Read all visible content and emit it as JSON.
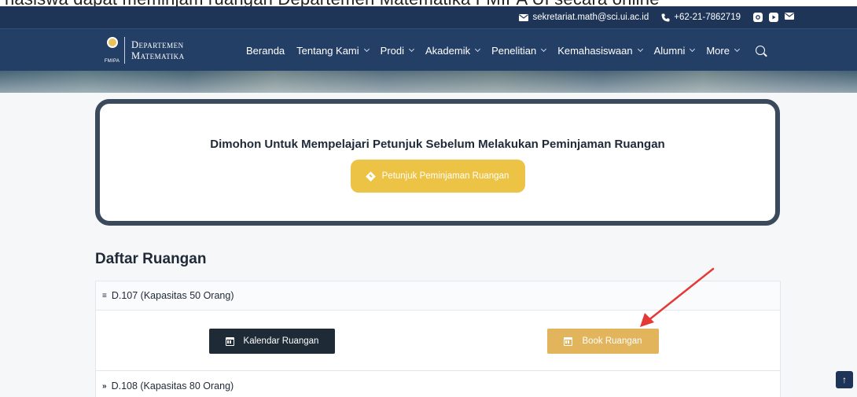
{
  "caption": {
    "text": "nasiswa dapat meminjam ruangan Departemen Matematika FMIPA UI secara online"
  },
  "topbar": {
    "email": "sekretariat.math@sci.ui.ac.id",
    "phone": "+62-21-7862719",
    "icons": [
      "mail-icon",
      "phone-icon",
      "instagram-icon",
      "youtube-icon",
      "envelope-icon"
    ]
  },
  "brand": {
    "line1": "Departemen",
    "line2": "Matematika",
    "fmipa": "FMIPA"
  },
  "nav": {
    "beranda": "Beranda",
    "tentang": "Tentang Kami",
    "prodi": "Prodi",
    "akademik": "Akademik",
    "penelitian": "Penelitian",
    "kemahasiswaan": "Kemahasiswaan",
    "alumni": "Alumni",
    "more": "More"
  },
  "notice": {
    "title": "Dimohon Untuk Mempelajari Petunjuk Sebelum Melakukan Peminjaman Ruangan",
    "button": "Petunjuk Peminjaman Ruangan"
  },
  "rooms": {
    "title": "Daftar Ruangan",
    "items": [
      {
        "label": "D.107 (Kapasitas 50 Orang)",
        "expanded": true
      },
      {
        "label": "D.108 (Kapasitas 80 Orang)",
        "expanded": false
      }
    ],
    "calendar_button": "Kalendar Ruangan",
    "book_button": "Book Ruangan"
  },
  "colors": {
    "topbar": "#1e3558",
    "navbar": "#243f66",
    "gold": "#ecc344",
    "book": "#e2b55d",
    "dark_button": "#1f2a37",
    "annotation_arrow": "#e53935"
  },
  "scroll_top": "↑"
}
